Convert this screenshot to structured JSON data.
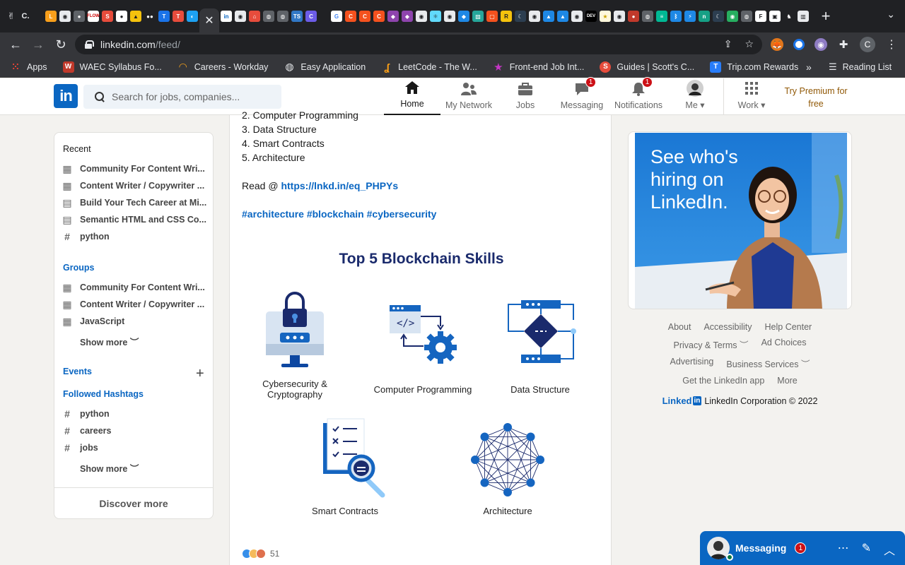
{
  "browser": {
    "url_host": "linkedin.com",
    "url_path": "/feed/",
    "bookmarks": [
      {
        "label": "Apps",
        "color": "#e8453c"
      },
      {
        "label": "WAEC Syllabus Fo...",
        "color": "#c0392b"
      },
      {
        "label": "Careers - Workday",
        "color": "#f4a11c"
      },
      {
        "label": "Easy Application",
        "color": "#888888"
      },
      {
        "label": "LeetCode - The W...",
        "color": "#ffa116"
      },
      {
        "label": "Front-end Job Int...",
        "color": "#c735c7"
      },
      {
        "label": "Guides | Scott's C...",
        "color": "#e74c3c"
      },
      {
        "label": "Trip.com Rewards",
        "color": "#287dfa"
      }
    ],
    "reading_list": "Reading List",
    "profile_letter": "C"
  },
  "nav": {
    "search_placeholder": "Search for jobs, companies...",
    "items": [
      {
        "label": "Home"
      },
      {
        "label": "My Network"
      },
      {
        "label": "Jobs"
      },
      {
        "label": "Messaging",
        "badge": "1"
      },
      {
        "label": "Notifications",
        "badge": "1"
      },
      {
        "label": "Me"
      },
      {
        "label": "Work"
      }
    ],
    "premium": "Try Premium for free"
  },
  "sidebar": {
    "recent_heading": "Recent",
    "recent": [
      "Community For Content Wri...",
      "Content Writer / Copywriter ...",
      "Build Your Tech Career at Mi...",
      "Semantic HTML and CSS Co...",
      "python"
    ],
    "groups_heading": "Groups",
    "groups": [
      "Community For Content Wri...",
      "Content Writer / Copywriter ...",
      "JavaScript"
    ],
    "show_more": "Show more",
    "events_heading": "Events",
    "hashtags_heading": "Followed Hashtags",
    "hashtags": [
      "python",
      "careers",
      "jobs"
    ],
    "discover_more": "Discover more"
  },
  "post": {
    "line2": "2. Computer Programming",
    "line3": "3. Data Structure",
    "line4": "4. Smart Contracts",
    "line5": "5. Architecture",
    "read_prefix": "Read @ ",
    "read_link": "https://lnkd.in/eq_PHPYs",
    "hashtags": "#architecture #blockchain #cybersecurity",
    "graphic_title": "Top 5 Blockchain Skills",
    "skill1": "Cybersecurity & Cryptography",
    "skill2": "Computer Programming",
    "skill3": "Data Structure",
    "skill4": "Smart Contracts",
    "skill5": "Architecture",
    "reaction_count": "51"
  },
  "ad": {
    "line1": "See who's",
    "line2": "hiring on",
    "line3": "LinkedIn."
  },
  "footer": {
    "about": "About",
    "accessibility": "Accessibility",
    "help": "Help Center",
    "privacy": "Privacy & Terms",
    "ad_choices": "Ad Choices",
    "advertising": "Advertising",
    "business": "Business Services",
    "app": "Get the LinkedIn app",
    "more": "More",
    "brand_word": "Linked",
    "brand_in": "in",
    "copyright": "LinkedIn Corporation © 2022"
  },
  "messaging": {
    "title": "Messaging",
    "badge": "1"
  }
}
